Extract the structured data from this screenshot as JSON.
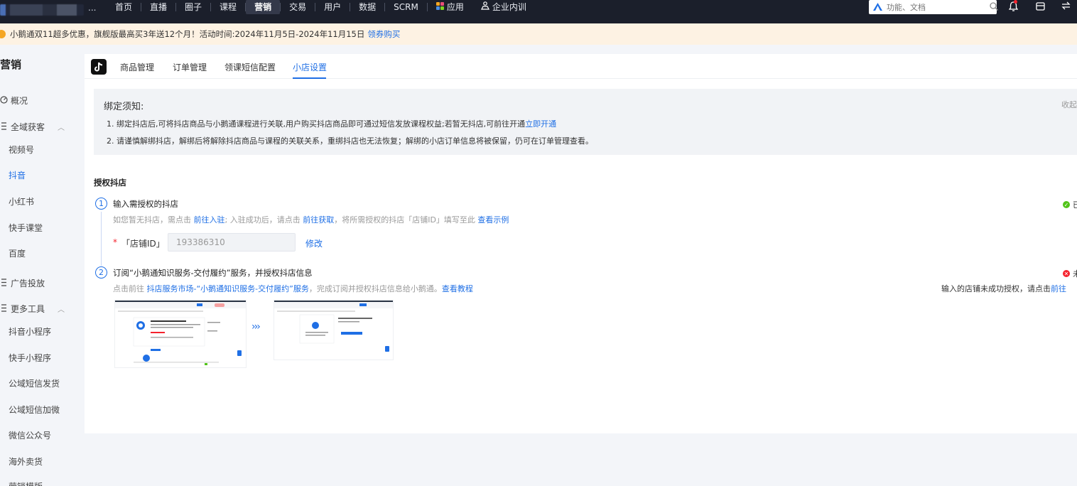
{
  "topnav": {
    "more": "...",
    "items": [
      "首页",
      "直播",
      "圈子",
      "课程",
      "营销",
      "交易",
      "用户",
      "数据",
      "SCRM",
      "应用",
      "企业内训"
    ],
    "active_index": 4,
    "search_placeholder": "功能、文档"
  },
  "banner": {
    "text": "小鹅通双11超多优惠，旗舰版最高买3年送12个月！活动时间:2024年11月5日-2024年11月15日",
    "link": "领券购买"
  },
  "sidebar": {
    "title": "营销",
    "items": [
      {
        "label": "概况",
        "type": "main"
      },
      {
        "label": "全域获客",
        "type": "main"
      },
      {
        "label": "视频号",
        "type": "sub"
      },
      {
        "label": "抖音",
        "type": "sub",
        "active": true
      },
      {
        "label": "小红书",
        "type": "sub"
      },
      {
        "label": "快手课堂",
        "type": "sub"
      },
      {
        "label": "百度",
        "type": "sub"
      },
      {
        "label": "广告投放",
        "type": "main"
      },
      {
        "label": "更多工具",
        "type": "main"
      },
      {
        "label": "抖音小程序",
        "type": "sub"
      },
      {
        "label": "快手小程序",
        "type": "sub"
      },
      {
        "label": "公域短信发货",
        "type": "sub"
      },
      {
        "label": "公域短信加微",
        "type": "sub"
      },
      {
        "label": "微信公众号",
        "type": "sub"
      },
      {
        "label": "海外卖货",
        "type": "sub"
      },
      {
        "label": "营销模版",
        "type": "sub"
      }
    ]
  },
  "tabs": [
    "商品管理",
    "订单管理",
    "领课短信配置",
    "小店设置"
  ],
  "active_tab": 3,
  "notice": {
    "title": "绑定须知:",
    "collapse": "收起",
    "line1": "1. 绑定抖店后,可将抖店商品与小鹅通课程进行关联,用户购买抖店商品即可通过短信发放课程权益;若暂无抖店,可前往开通",
    "line1_link": "立即开通",
    "line2": "2. 请谨慎解绑抖店，解绑后将解除抖店商品与课程的关联关系，重绑抖店也无法恢复；解绑的小店订单信息将被保留，仍可在订单管理查看。"
  },
  "auth": {
    "title": "授权抖店",
    "step1": {
      "num": "1",
      "title": "输入需授权的抖店",
      "desc_a": "如您暂无抖店，需点击",
      "link_a": "前往入驻",
      "desc_b": "; 入驻成功后，请点击",
      "link_b": "前往获取",
      "desc_c": "，将所需授权的抖店「店铺ID」填写至此",
      "link_c": "查看示例",
      "field_required": "*",
      "field_label": "「店铺ID」",
      "field_value": "193386310",
      "edit": "修改",
      "status": "已"
    },
    "step2": {
      "num": "2",
      "title": "订阅“小鹅通知识服务-交付履约”服务，并授权抖店信息",
      "desc_a": "点击前往",
      "link_a": "抖店服务市场-“小鹅通知识服务-交付履约”服务",
      "desc_b": "，完成订阅并授权抖店信息给小鹅通。",
      "link_b": "查看教程",
      "status": "未",
      "hint": "输入的店铺未成功授权，请点击",
      "hint_link": "前往"
    },
    "arrows": "›››"
  }
}
